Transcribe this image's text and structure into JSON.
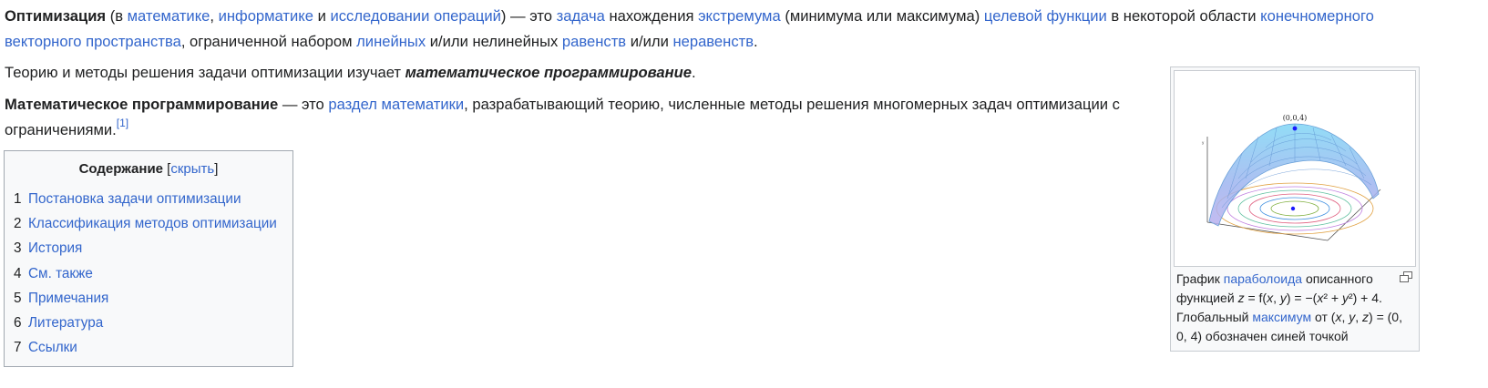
{
  "intro": {
    "term": "Оптимизация",
    "t1": " (в ",
    "l_math": "математике",
    "t2": ", ",
    "l_cs": "информатике",
    "t3": " и ",
    "l_or": "исследовании операций",
    "t4": ") — это ",
    "l_task": "задача",
    "t5": " нахождения ",
    "l_extremum": "экстремума",
    "t6": " (минимума или максимума) ",
    "l_objective": "целевой функции",
    "t7": " в некоторой области ",
    "l_space": "конечномерного векторного пространства",
    "t8": ", ограниченной набором ",
    "l_linear": "линейных",
    "t9": " и/или нелинейных ",
    "l_eq": "равенств",
    "t10": " и/или ",
    "l_ineq": "неравенств",
    "t11": "."
  },
  "para2": {
    "text": "Теорию и методы решения задачи оптимизации изучает ",
    "bold_italic": "математическое программирование",
    "end": "."
  },
  "para3": {
    "term": "Математическое программирование",
    "t1": " — это ",
    "l_branch": "раздел математики",
    "t2": ", разрабатывающий теорию, численные методы решения многомерных задач оптимизации с ограничениями.",
    "ref": "[1]"
  },
  "toc": {
    "title": "Содержание",
    "bracket_open": " [",
    "hide": "скрыть",
    "bracket_close": "]",
    "items": [
      {
        "num": "1",
        "label": "Постановка задачи оптимизации"
      },
      {
        "num": "2",
        "label": "Классификация методов оптимизации"
      },
      {
        "num": "3",
        "label": "История"
      },
      {
        "num": "4",
        "label": "См. также"
      },
      {
        "num": "5",
        "label": "Примечания"
      },
      {
        "num": "6",
        "label": "Литература"
      },
      {
        "num": "7",
        "label": "Ссылки"
      }
    ]
  },
  "thumb": {
    "image_label": "(0,0,4)",
    "axis_y": "y",
    "caption": {
      "c1": "График ",
      "l_paraboloid": "параболоида",
      "c2": " описанного функцией ",
      "z": "z",
      "c3": " = f(",
      "x1": "x",
      "c4": ", ",
      "y1": "y",
      "c5": ") = −(",
      "x2": "x",
      "c6": "² + ",
      "y2": "y",
      "c7": "²) + 4. Глобальный ",
      "l_max": "максимум",
      "c8": " от (",
      "x3": "x",
      "c9": ", ",
      "y3": "y",
      "c10": ", ",
      "z2": "z",
      "c11": ") = (0, 0, 4) обозначен синей точкой"
    }
  },
  "icons": {
    "magnify": "magnify-clip-icon"
  },
  "colors": {
    "link": "#3366cc",
    "text": "#202122",
    "dot": "#1a1aff"
  }
}
